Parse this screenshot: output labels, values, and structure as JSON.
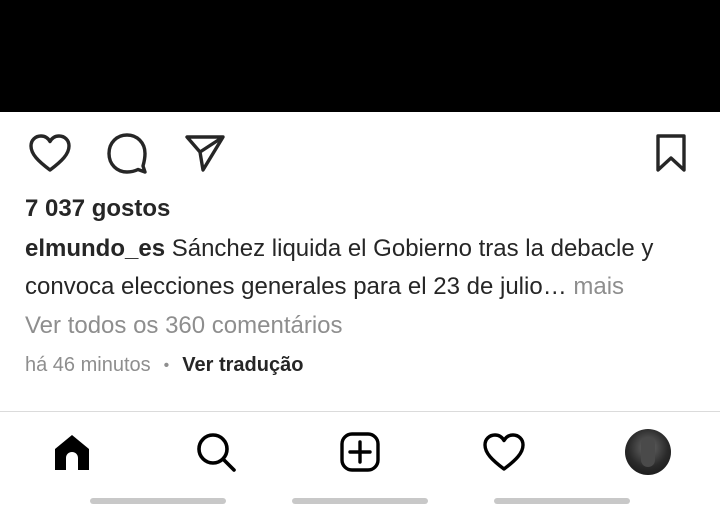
{
  "post": {
    "likes": "7 037 gostos",
    "username": "elmundo_es",
    "caption": " Sánchez liquida el Gobierno tras la debacle y convoca elecciones generales para el 23 de julio",
    "ellipsis": "…",
    "more_label": " mais",
    "view_comments": "Ver todos os 360 comentários",
    "time": "há 46 minutos",
    "separator": "•",
    "translate_label": "Ver tradução"
  },
  "icons": {
    "like": "heart-outline-icon",
    "comment": "speech-bubble-icon",
    "share": "paper-plane-icon",
    "save": "bookmark-icon"
  },
  "nav": {
    "items": [
      "home-icon",
      "search-icon",
      "new-post-icon",
      "activity-heart-icon",
      "profile-avatar"
    ]
  },
  "colors": {
    "text": "#262626",
    "secondary": "#8e8e8e",
    "divider": "#dbdbdb",
    "media_bg": "#000000"
  }
}
